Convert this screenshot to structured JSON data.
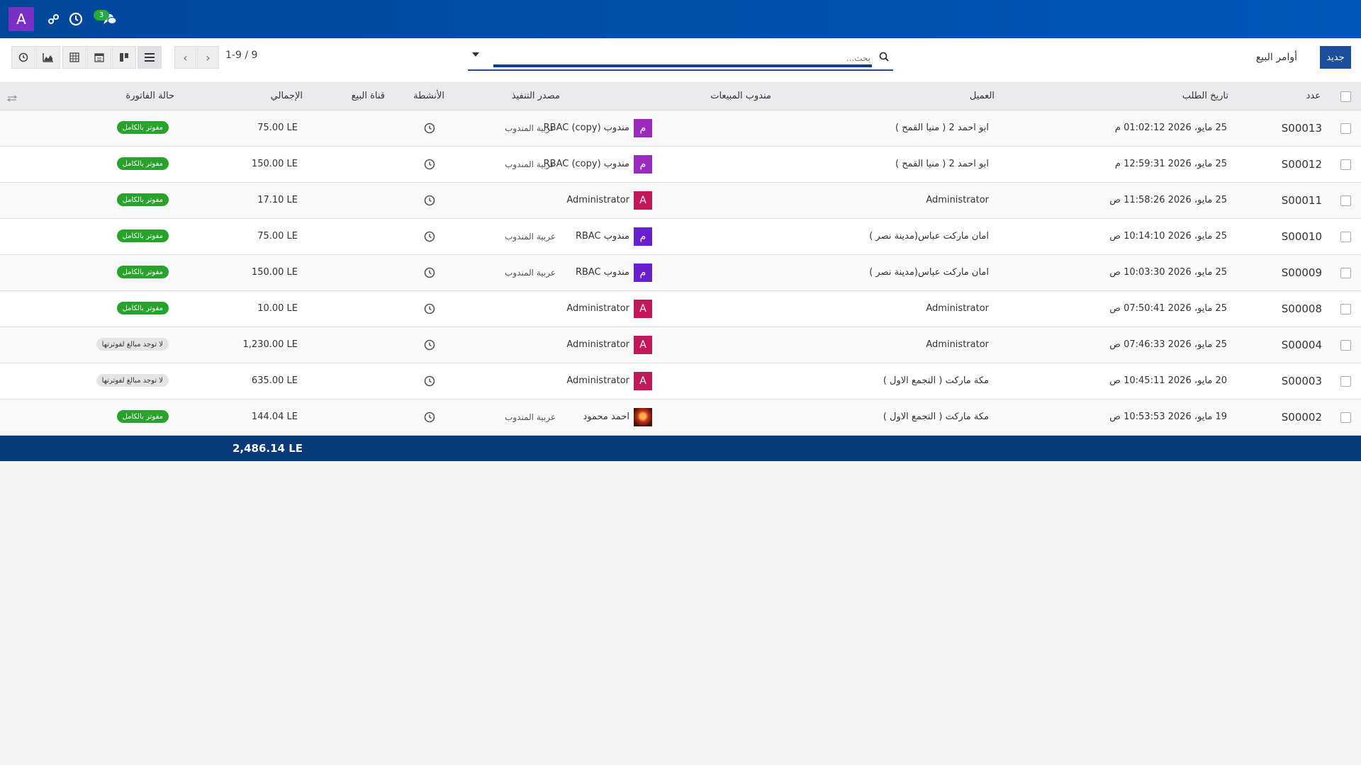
{
  "navbar": {
    "avatar_letter": "A",
    "message_count": "3",
    "icons": [
      "apps-icon",
      "clock-icon",
      "chat-icon"
    ]
  },
  "control": {
    "new_button": "جديد",
    "breadcrumb": "أوامر البيع",
    "search_placeholder": "بحث...",
    "pager_value": "1-9 / 9",
    "views": [
      "list-view-icon",
      "kanban-view-icon",
      "calendar-view-icon",
      "pivot-view-icon",
      "graph-view-icon",
      "activity-view-icon"
    ]
  },
  "table": {
    "headers": {
      "number": "عدد",
      "order_date": "تاريخ الطلب",
      "customer": "العميل",
      "salesperson": "مندوب المبيعات",
      "source": "مصدر التنفيذ",
      "activities": "الأنشطة",
      "channel": "قناة البيع",
      "total": "الإجمالي",
      "invoice_status": "حالة الفاتورة"
    },
    "rows": [
      {
        "number": "S00013",
        "date": "25 مايو، 2026 01:02:12 م",
        "customer": "ابو احمد 2 ( منيا القمح )",
        "salesperson": "مندوب RBAC (copy)",
        "avatar": "م",
        "avatar_color": "#9b2bbf",
        "source": "عربية المندوب",
        "total": "75.00 LE",
        "status": "مفوتر بالكامل",
        "status_type": "green"
      },
      {
        "number": "S00012",
        "date": "25 مايو، 2026 12:59:31 م",
        "customer": "ابو احمد 2 ( منيا القمح )",
        "salesperson": "مندوب RBAC (copy)",
        "avatar": "م",
        "avatar_color": "#9b2bbf",
        "source": "عربية المندوب",
        "total": "150.00 LE",
        "status": "مفوتر بالكامل",
        "status_type": "green"
      },
      {
        "number": "S00011",
        "date": "25 مايو، 2026 11:58:26 ص",
        "customer": "Administrator",
        "salesperson": "Administrator",
        "avatar": "A",
        "avatar_color": "#c2185b",
        "source": "",
        "total": "17.10 LE",
        "status": "مفوتر بالكامل",
        "status_type": "green"
      },
      {
        "number": "S00010",
        "date": "25 مايو، 2026 10:14:10 ص",
        "customer": "امان ماركت عباس(مدينة نصر )",
        "salesperson": "مندوب RBAC",
        "avatar": "م",
        "avatar_color": "#6a1fcf",
        "source": "عربية المندوب",
        "total": "75.00 LE",
        "status": "مفوتر بالكامل",
        "status_type": "green"
      },
      {
        "number": "S00009",
        "date": "25 مايو، 2026 10:03:30 ص",
        "customer": "امان ماركت عباس(مدينة نصر )",
        "salesperson": "مندوب RBAC",
        "avatar": "م",
        "avatar_color": "#6a1fcf",
        "source": "عربية المندوب",
        "total": "150.00 LE",
        "status": "مفوتر بالكامل",
        "status_type": "green"
      },
      {
        "number": "S00008",
        "date": "25 مايو، 2026 07:50:41 ص",
        "customer": "Administrator",
        "salesperson": "Administrator",
        "avatar": "A",
        "avatar_color": "#c2185b",
        "source": "",
        "total": "10.00 LE",
        "status": "مفوتر بالكامل",
        "status_type": "green"
      },
      {
        "number": "S00004",
        "date": "25 مايو، 2026 07:46:33 ص",
        "customer": "Administrator",
        "salesperson": "Administrator",
        "avatar": "A",
        "avatar_color": "#c2185b",
        "source": "",
        "total": "1,230.00 LE",
        "status": "لا توجد مبالغ لفوترتها",
        "status_type": "grey"
      },
      {
        "number": "S00003",
        "date": "20 مايو، 2026 10:45:11 ص",
        "customer": "مكة ماركت ( التجمع الاول )",
        "salesperson": "Administrator",
        "avatar": "A",
        "avatar_color": "#c2185b",
        "source": "",
        "total": "635.00 LE",
        "status": "لا توجد مبالغ لفوترتها",
        "status_type": "grey"
      },
      {
        "number": "S00002",
        "date": "19 مايو، 2026 10:53:53 ص",
        "customer": "مكة ماركت ( التجمع الاول )",
        "salesperson": "احمد محمود",
        "avatar": "",
        "avatar_color": "image",
        "source": "عربية المندوب",
        "total": "144.04 LE",
        "status": "مفوتر بالكامل",
        "status_type": "green"
      }
    ],
    "footer_total": "2,486.14 LE"
  }
}
